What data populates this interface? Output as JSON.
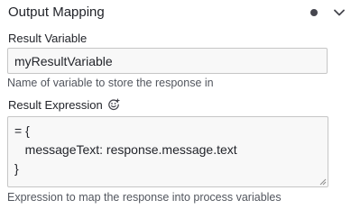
{
  "header": {
    "title": "Output Mapping",
    "status_icon": "dot-icon",
    "toggle_icon": "chevron-down-icon"
  },
  "result_variable": {
    "label": "Result Variable",
    "value": "myResultVariable",
    "help": "Name of variable to store the response in"
  },
  "result_expression": {
    "label": "Result Expression",
    "feel_icon": "feel-expression-icon",
    "lines": [
      "= {",
      "   messageText: response.message.text",
      "}"
    ],
    "help": "Expression to map the response into process variables"
  }
}
